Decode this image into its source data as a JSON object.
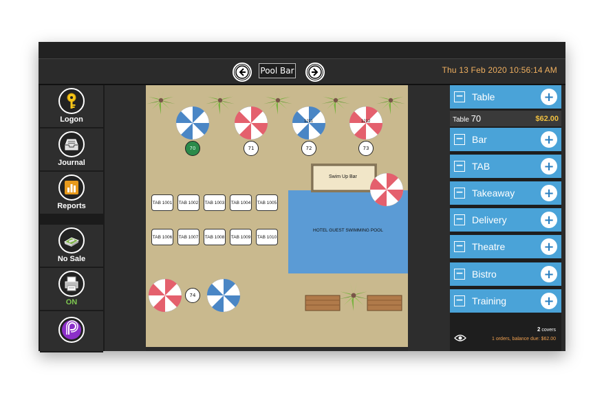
{
  "header": {
    "title": "Pool Bar",
    "datetime": "Thu 13 Feb 2020  10:56:14 AM",
    "prev_icon": "arrow-left-icon",
    "next_icon": "arrow-right-icon"
  },
  "sidebar": {
    "items": [
      {
        "label": "Logon",
        "icon": "key-icon"
      },
      {
        "label": "Journal",
        "icon": "inbox-tray-icon"
      },
      {
        "label": "Reports",
        "icon": "bar-chart-icon"
      },
      {
        "label": "No Sale",
        "icon": "cash-register-icon"
      },
      {
        "label": "ON",
        "icon": "printer-icon"
      },
      {
        "label": "",
        "icon": "brand-logo-icon"
      }
    ]
  },
  "floor": {
    "tables": [
      {
        "label": "70",
        "active": true
      },
      {
        "label": "71",
        "active": false
      },
      {
        "label": "72",
        "active": false
      },
      {
        "label": "73",
        "active": false
      },
      {
        "label": "74",
        "active": false
      }
    ],
    "tabs": [
      "TAB 1001",
      "TAB 1002",
      "TAB 1003",
      "TAB 1004",
      "TAB 1005",
      "TAB 1006",
      "TAB 1007",
      "TAB 1008",
      "TAB 1009",
      "TAB 1010"
    ],
    "swim_up_bar": "Swim Up Bar",
    "pool_label": "HOTEL GUEST SWIMMING POOL",
    "umbrella_labels": [
      "1211",
      "1212"
    ]
  },
  "right_panel": {
    "categories": [
      "Table",
      "Bar",
      "TAB",
      "Takeaway",
      "Delivery",
      "Theatre",
      "Bistro",
      "Training"
    ],
    "selected_table": {
      "prefix": "Table",
      "number": "70",
      "amount": "$62.00"
    },
    "covers": {
      "count": "2",
      "label": "covers"
    },
    "balance": "1 orders, balance due: $62.00"
  },
  "colors": {
    "accent_blue": "#4aa3d8",
    "amount_gold": "#f0c040",
    "datetime_orange": "#f0b060",
    "active_table_green": "#2b8a4a",
    "pool_blue": "#5b9bd5",
    "sand": "#c9b98e"
  }
}
